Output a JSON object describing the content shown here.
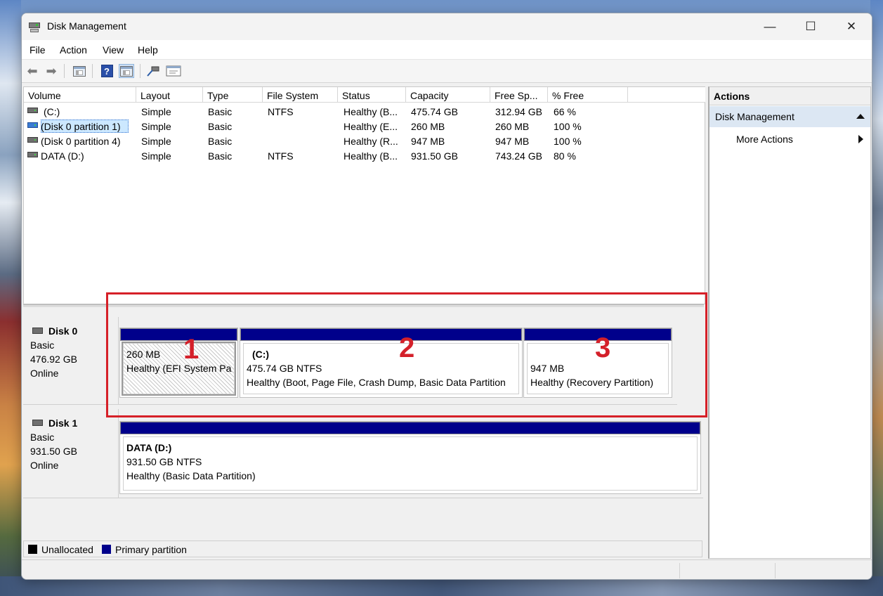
{
  "window": {
    "title": "Disk Management",
    "controls": {
      "minimize": "—",
      "maximize": "☐",
      "close": "✕"
    }
  },
  "menu": [
    "File",
    "Action",
    "View",
    "Help"
  ],
  "toolbar": {
    "icons": [
      "back-arrow-icon",
      "forward-arrow-icon",
      "show-hide-console-tree-icon",
      "help-icon",
      "show-action-pane-icon",
      "connect-disk-icon",
      "properties-icon"
    ],
    "help_glyph": "?"
  },
  "volume_list": {
    "columns": [
      "Volume",
      "Layout",
      "Type",
      "File System",
      "Status",
      "Capacity",
      "Free Sp...",
      "% Free"
    ],
    "rows": [
      {
        "volume": "(C:)",
        "layout": "Simple",
        "type": "Basic",
        "fs": "NTFS",
        "status": "Healthy (B...",
        "capacity": "475.74 GB",
        "free": "312.94 GB",
        "pct": "66 %"
      },
      {
        "volume": "(Disk 0 partition 1)",
        "layout": "Simple",
        "type": "Basic",
        "fs": "",
        "status": "Healthy (E...",
        "capacity": "260 MB",
        "free": "260 MB",
        "pct": "100 %"
      },
      {
        "volume": "(Disk 0 partition 4)",
        "layout": "Simple",
        "type": "Basic",
        "fs": "",
        "status": "Healthy (R...",
        "capacity": "947 MB",
        "free": "947 MB",
        "pct": "100 %"
      },
      {
        "volume": "DATA (D:)",
        "layout": "Simple",
        "type": "Basic",
        "fs": "NTFS",
        "status": "Healthy (B...",
        "capacity": "931.50 GB",
        "free": "743.24 GB",
        "pct": "80 %"
      }
    ]
  },
  "disks": [
    {
      "name": "Disk 0",
      "kind": "Basic",
      "size": "476.92 GB",
      "state": "Online",
      "partitions": [
        {
          "label": "",
          "size": "260 MB",
          "status": "Healthy (EFI System Pa"
        },
        {
          "label": "(C:)",
          "size": "475.74 GB NTFS",
          "status": "Healthy (Boot, Page File, Crash Dump, Basic Data Partition"
        },
        {
          "label": "",
          "size": "947 MB",
          "status": "Healthy (Recovery Partition)"
        }
      ]
    },
    {
      "name": "Disk 1",
      "kind": "Basic",
      "size": "931.50 GB",
      "state": "Online",
      "partitions": [
        {
          "label": "DATA  (D:)",
          "size": "931.50 GB NTFS",
          "status": "Healthy (Basic Data Partition)"
        }
      ]
    }
  ],
  "annotations": [
    "1",
    "2",
    "3"
  ],
  "legend": [
    {
      "label": "Unallocated",
      "color": "#000000"
    },
    {
      "label": "Primary partition",
      "color": "#00008b"
    }
  ],
  "actions": {
    "header": "Actions",
    "section": "Disk Management",
    "more": "More Actions"
  },
  "colors": {
    "primary_partition": "#00008b",
    "highlight": "#d62028",
    "selection": "#cce8ff"
  }
}
